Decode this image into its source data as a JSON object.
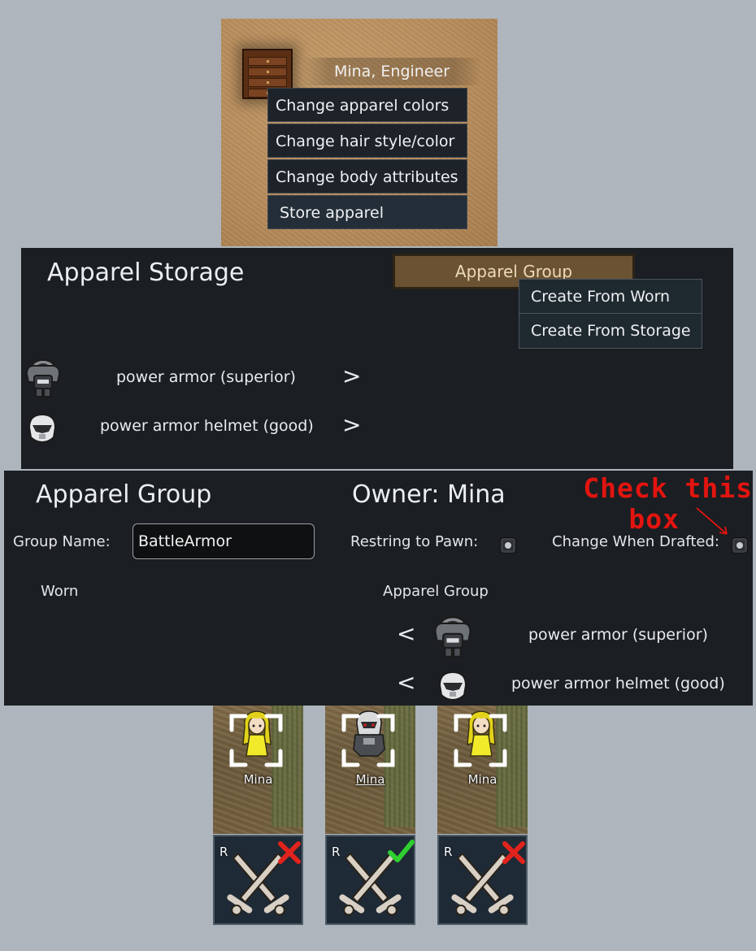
{
  "furniture_menu": {
    "pawn_label": "Mina, Engineer",
    "items": [
      {
        "label": "Change apparel colors"
      },
      {
        "label": "Change hair style/color"
      },
      {
        "label": "Change body attributes"
      },
      {
        "label": "Store apparel"
      }
    ]
  },
  "storage_window": {
    "title": "Apparel Storage",
    "group_button_label": "Apparel Group",
    "group_menu": [
      {
        "label": "Create From Worn"
      },
      {
        "label": "Create From Storage"
      }
    ],
    "items": [
      {
        "label": "power armor (superior)",
        "icon": "power-armor-icon",
        "arrow": ">"
      },
      {
        "label": "power armor helmet (good)",
        "icon": "power-armor-helmet-icon",
        "arrow": ">"
      }
    ]
  },
  "group_window": {
    "title": "Apparel Group",
    "owner_label": "Owner: Mina",
    "group_name_label": "Group Name:",
    "group_name_value": "BattleArmor",
    "restrict_label": "Restring to Pawn:",
    "change_drafted_label": "Change When Drafted:",
    "worn_label": "Worn",
    "apparel_group_label": "Apparel Group",
    "items": [
      {
        "label": "power armor (superior)",
        "icon": "power-armor-icon",
        "arrow": "<"
      },
      {
        "label": "power armor helmet (good)",
        "icon": "power-armor-helmet-icon",
        "arrow": "<"
      }
    ]
  },
  "annotation": {
    "line1": "Check this",
    "line2": "box",
    "color": "#e3140f"
  },
  "pawns": [
    {
      "name": "Mina",
      "appearance": "blonde-yellow-dress",
      "draft_marker": "R",
      "draft_status": "undrafted-x-icon"
    },
    {
      "name": "Mina",
      "appearance": "power-armor",
      "draft_marker": "R",
      "draft_status": "drafted-check-icon"
    },
    {
      "name": "Mina",
      "appearance": "blonde-yellow-dress",
      "draft_marker": "R",
      "draft_status": "undrafted-x-icon"
    }
  ],
  "colors": {
    "window_bg": "#1b1e22",
    "menu_bg": "#1e232a",
    "button_brown": "#6a5232",
    "background": "#aeb5bd",
    "x_red": "#e0231c",
    "check_green": "#2fcf2f"
  }
}
